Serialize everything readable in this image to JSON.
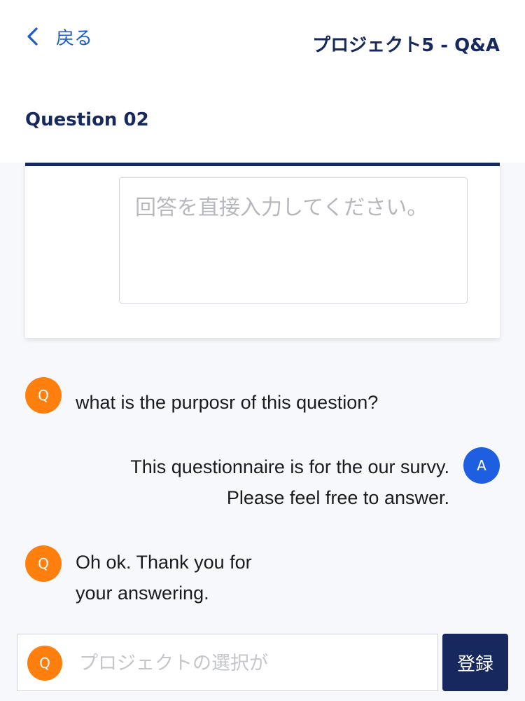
{
  "status_color": "#2ecc71",
  "header": {
    "back_label": "戻る",
    "back_icon": "chevron-left-icon",
    "title": "プロジェクト5 - Q&A"
  },
  "question": {
    "label": "Question 02",
    "answer_placeholder": "回答を直接入力してください。"
  },
  "chat": {
    "messages": [
      {
        "role": "Q",
        "text": "what is the purposr of this question?"
      },
      {
        "role": "A",
        "text": "This questionnaire is for the our survy. Please feel free to answer."
      },
      {
        "role": "Q",
        "text": "Oh ok. Thank you for your answering."
      }
    ]
  },
  "input_bar": {
    "avatar_label": "Q",
    "placeholder": "プロジェクトの選択が",
    "submit_label": "登録"
  },
  "colors": {
    "navy": "#16285e",
    "link_blue": "#1d5fc7",
    "question_orange": "#ff7f0e",
    "answer_blue": "#1d5fe0"
  }
}
